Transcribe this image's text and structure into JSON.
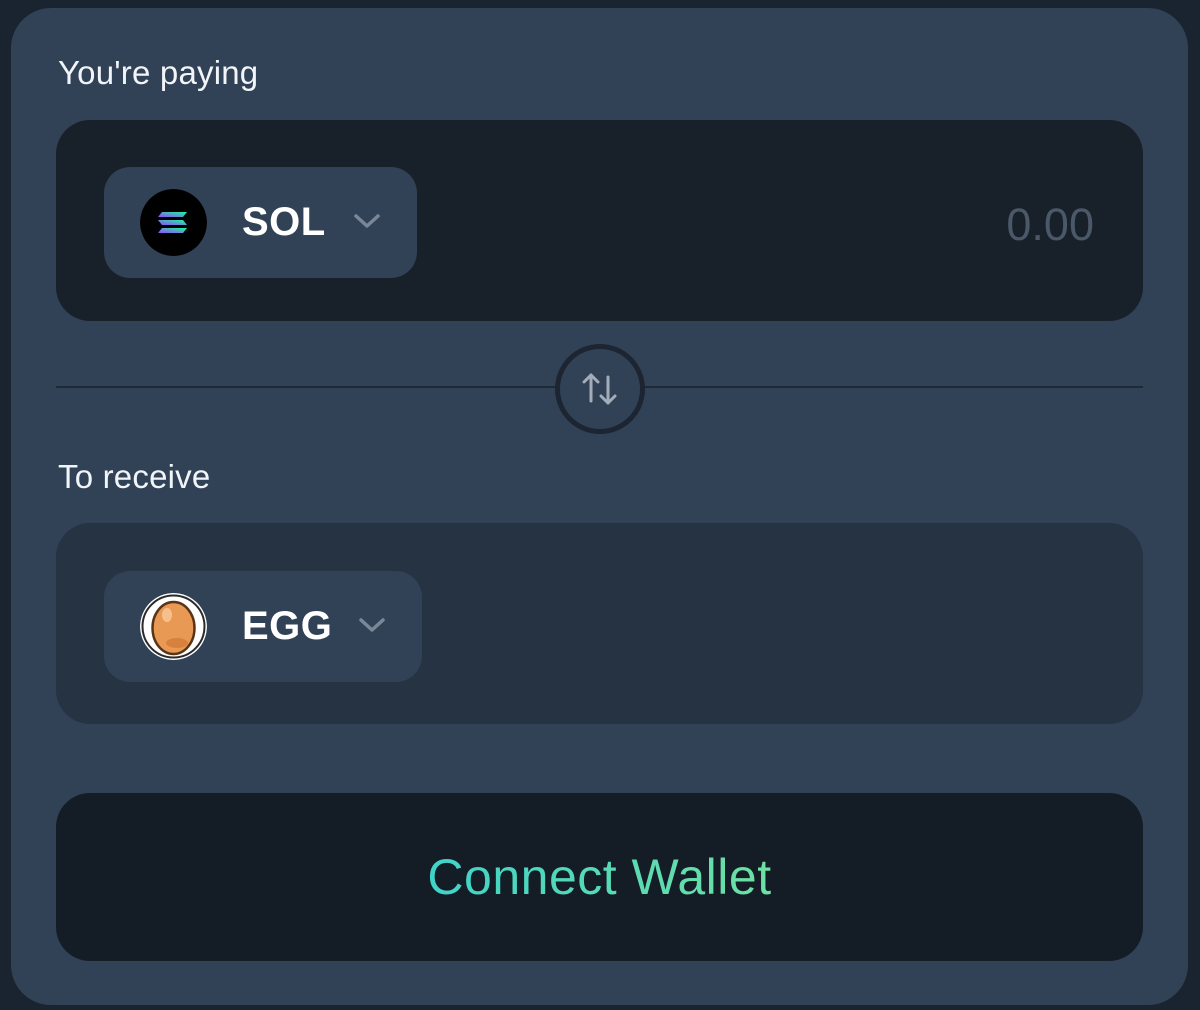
{
  "pay": {
    "label": "You're paying",
    "token": {
      "symbol": "SOL",
      "icon": "solana-logo-icon"
    },
    "amount_placeholder": "0.00"
  },
  "swap": {
    "icon": "swap-arrows-icon"
  },
  "receive": {
    "label": "To receive",
    "token": {
      "symbol": "EGG",
      "icon": "egg-logo-icon"
    }
  },
  "connect": {
    "label": "Connect Wallet"
  },
  "colors": {
    "card": "#314256",
    "pay_panel": "#18202a",
    "receive_panel": "#263343",
    "accent_start": "#3fd3c9",
    "accent_end": "#6ee0a3"
  }
}
